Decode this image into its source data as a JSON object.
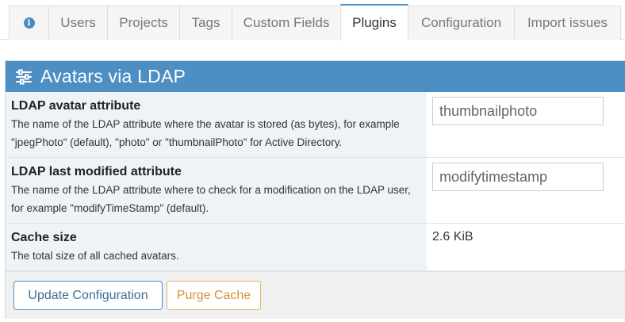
{
  "tabs": [
    {
      "label": "",
      "icon": "info-icon"
    },
    {
      "label": "Users"
    },
    {
      "label": "Projects"
    },
    {
      "label": "Tags"
    },
    {
      "label": "Custom Fields"
    },
    {
      "label": "Plugins",
      "active": true
    },
    {
      "label": "Configuration"
    },
    {
      "label": "Import issues"
    }
  ],
  "panel": {
    "title": "Avatars via LDAP",
    "icon": "sliders-icon",
    "header_color": "#4d8ec3"
  },
  "settings": [
    {
      "title": "LDAP avatar attribute",
      "description": "The name of the LDAP attribute where the avatar is stored (as bytes), for example \"jpegPhoto\" (default), \"photo\" or \"thumbnailPhoto\" for Active Directory.",
      "value": "thumbnailphoto"
    },
    {
      "title": "LDAP last modified attribute",
      "description": "The name of the LDAP attribute where to check for a modification on the LDAP user, for example \"modifyTimeStamp\" (default).",
      "value": "modifytimestamp"
    },
    {
      "title": "Cache size",
      "description": "The total size of all cached avatars.",
      "value": "2.6 KiB"
    }
  ],
  "buttons": {
    "update": "Update Configuration",
    "purge": "Purge Cache"
  }
}
